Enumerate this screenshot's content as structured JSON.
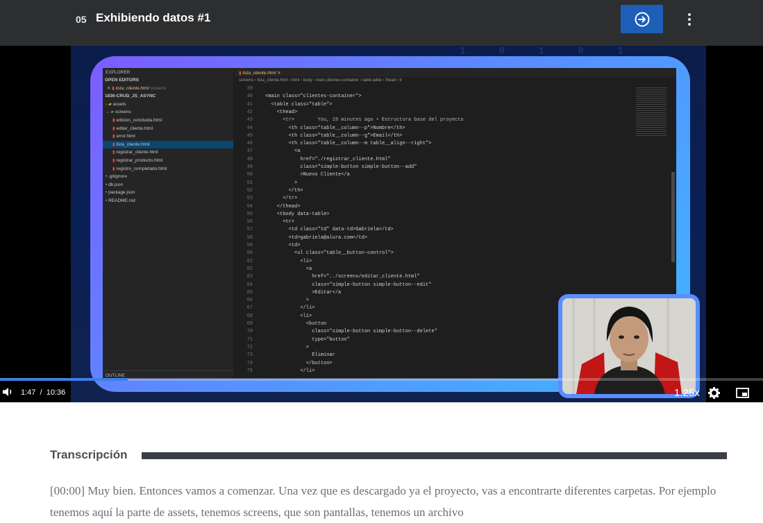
{
  "header": {
    "lesson_number": "05",
    "lesson_title": "Exhibiendo datos #1"
  },
  "editor": {
    "explorer_title": "EXPLORER",
    "open_editors": "OPEN EDITORS",
    "open_file": "lista_cliente.html",
    "open_file_dir": "screens",
    "project": "1836-CRUD_JS_ASYNC",
    "tree": [
      {
        "label": "assets",
        "type": "folder"
      },
      {
        "label": "screens",
        "type": "folder-open"
      },
      {
        "label": "edicion_concluida.html",
        "type": "file"
      },
      {
        "label": "editar_cliente.html",
        "type": "file"
      },
      {
        "label": "error.html",
        "type": "file"
      },
      {
        "label": "lista_cliente.html",
        "type": "file"
      },
      {
        "label": "registrar_cliente.html",
        "type": "file"
      },
      {
        "label": "registrar_producto.html",
        "type": "file"
      },
      {
        "label": "registro_completado.html",
        "type": "file"
      },
      {
        "label": ".gitignore",
        "type": "root"
      },
      {
        "label": "db.json",
        "type": "root"
      },
      {
        "label": "package.json",
        "type": "root"
      },
      {
        "label": "README.md",
        "type": "root"
      }
    ],
    "outline": "OUTLINE",
    "tab_label": "lista_cliente.html",
    "breadcrumbs": "screens › lista_cliente.html › html › body › main.clientes-container › table.table › thead › tr",
    "lines": [
      {
        "n": "39",
        "t": ""
      },
      {
        "n": "40",
        "t": "<main class=\"clientes-container\">"
      },
      {
        "n": "41",
        "t": "  <table class=\"table\">"
      },
      {
        "n": "42",
        "t": "    <thead>"
      },
      {
        "n": "43",
        "t": "      <tr>        You, 19 minutes ago • Estructura base del proyecto"
      },
      {
        "n": "44",
        "t": "        <th class=\"table__column--p\">Nombre</th>"
      },
      {
        "n": "45",
        "t": "        <th class=\"table__column--g\">Email</th>"
      },
      {
        "n": "46",
        "t": "        <th class=\"table__column--m table__align--right\">"
      },
      {
        "n": "47",
        "t": "          <a"
      },
      {
        "n": "48",
        "t": "            href=\"./registrar_cliente.html\""
      },
      {
        "n": "49",
        "t": "            class=\"simple-button simple-button--add\""
      },
      {
        "n": "50",
        "t": "            >Nuevo Cliente</a"
      },
      {
        "n": "51",
        "t": "          >"
      },
      {
        "n": "52",
        "t": "        </th>"
      },
      {
        "n": "53",
        "t": "      </tr>"
      },
      {
        "n": "54",
        "t": "    </thead>"
      },
      {
        "n": "55",
        "t": "    <tbody data-table>"
      },
      {
        "n": "56",
        "t": "      <tr>"
      },
      {
        "n": "57",
        "t": "        <td class=\"td\" data-td>Gabriela</td>"
      },
      {
        "n": "58",
        "t": "        <td>gabriela@alura.com</td>"
      },
      {
        "n": "59",
        "t": "        <td>"
      },
      {
        "n": "60",
        "t": "          <ul class=\"table__button-control\">"
      },
      {
        "n": "61",
        "t": "            <li>"
      },
      {
        "n": "62",
        "t": "              <a"
      },
      {
        "n": "63",
        "t": "                href=\"../screens/editar_cliente.html\""
      },
      {
        "n": "64",
        "t": "                class=\"simple-button simple-button--edit\""
      },
      {
        "n": "65",
        "t": "                >Editar</a"
      },
      {
        "n": "66",
        "t": "              >"
      },
      {
        "n": "67",
        "t": "            </li>"
      },
      {
        "n": "68",
        "t": "            <li>"
      },
      {
        "n": "69",
        "t": "              <button"
      },
      {
        "n": "70",
        "t": "                class=\"simple-button simple-button--delete\""
      },
      {
        "n": "71",
        "t": "                type=\"button\""
      },
      {
        "n": "72",
        "t": "              >"
      },
      {
        "n": "73",
        "t": "                Eliminar"
      },
      {
        "n": "74",
        "t": "              </button>"
      },
      {
        "n": "75",
        "t": "            </li>"
      }
    ]
  },
  "player": {
    "progress": 0.167,
    "current_time": "1:47",
    "separator": "/",
    "duration": "10:36",
    "speed": "1.25x",
    "accent": "#3d7fe6"
  },
  "transcript": {
    "heading": "Transcripción",
    "text": "[00:00] Muy bien. Entonces vamos a comenzar. Una vez que es descargado ya el proyecto, vas a encontrarte diferentes carpetas. Por ejemplo tenemos aquí la parte de assets, tenemos screens, que son pantallas, tenemos un archivo"
  },
  "colors": {
    "topbar": "#2d2e30",
    "next_button": "#1d5fb8",
    "frame_gradient_start": "#7c5cff",
    "frame_gradient_end": "#3fb6ff"
  }
}
